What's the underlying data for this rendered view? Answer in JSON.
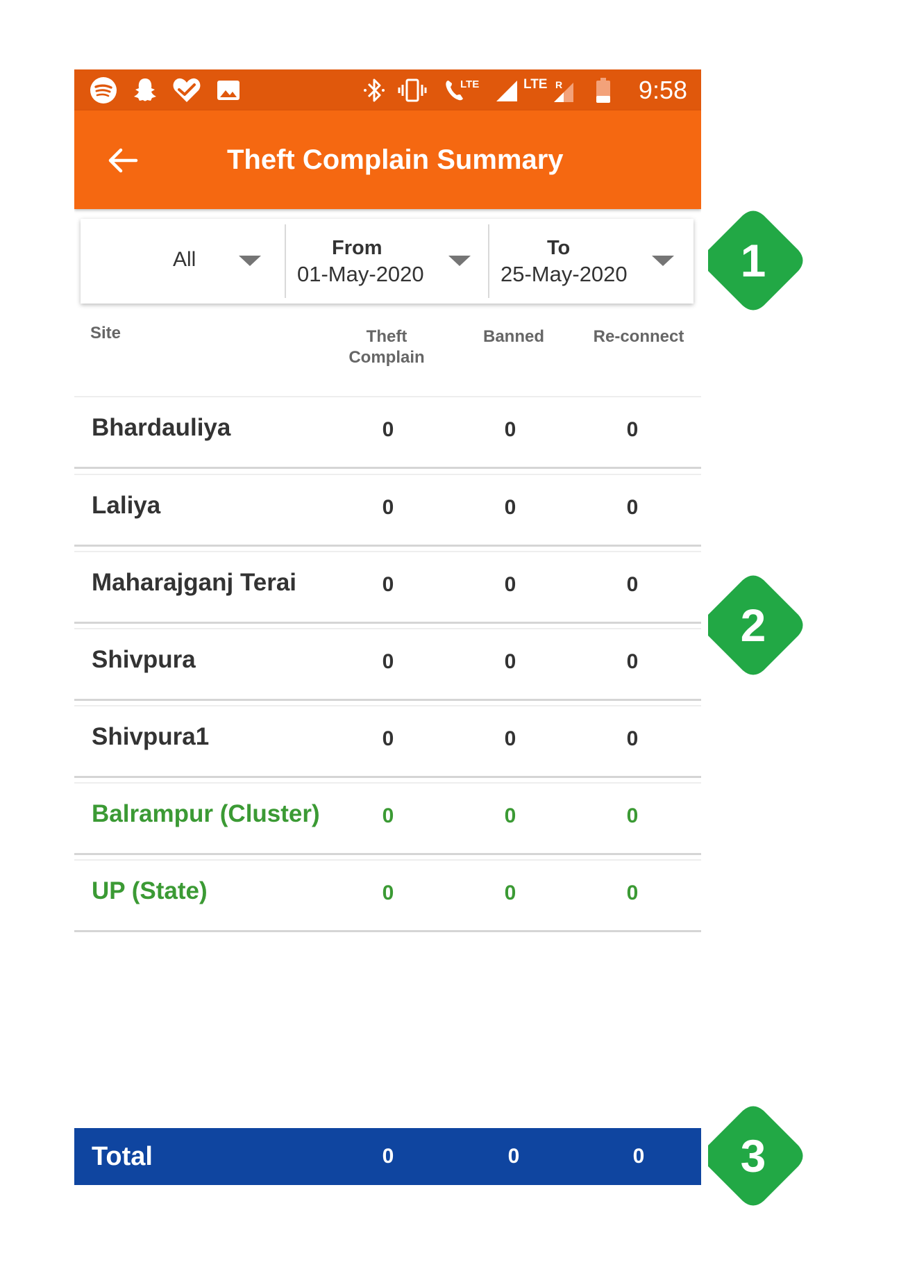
{
  "status_bar": {
    "time": "9:58",
    "left_icons": [
      "spotify-icon",
      "snapchat-icon",
      "health-heart-icon",
      "gallery-image-icon"
    ],
    "right_icons": [
      "bluetooth-icon",
      "vibrate-icon",
      "volte-call-icon",
      "signal-icon",
      "lte-roaming-signal-icon",
      "battery-icon"
    ],
    "lte_label": "LTE",
    "lte2_label": "LTE",
    "roaming_label": "R"
  },
  "app_bar": {
    "title": "Theft Complain Summary",
    "back_icon": "arrow-left-icon"
  },
  "filters": {
    "site_filter": "All",
    "from_label": "From",
    "from_value": "01-May-2020",
    "to_label": "To",
    "to_value": "25-May-2020"
  },
  "table": {
    "headers": {
      "site": "Site",
      "theft_line1": "Theft",
      "theft_line2": "Complain",
      "banned": "Banned",
      "reconnect": "Re-connect"
    },
    "rows": [
      {
        "site": "Bhardauliya",
        "theft": "0",
        "banned": "0",
        "reconnect": "0",
        "highlight": false
      },
      {
        "site": "Laliya",
        "theft": "0",
        "banned": "0",
        "reconnect": "0",
        "highlight": false
      },
      {
        "site": "Maharajganj Terai",
        "theft": "0",
        "banned": "0",
        "reconnect": "0",
        "highlight": false
      },
      {
        "site": "Shivpura",
        "theft": "0",
        "banned": "0",
        "reconnect": "0",
        "highlight": false
      },
      {
        "site": "Shivpura1",
        "theft": "0",
        "banned": "0",
        "reconnect": "0",
        "highlight": false
      },
      {
        "site": "Balrampur (Cluster)",
        "theft": "0",
        "banned": "0",
        "reconnect": "0",
        "highlight": true
      },
      {
        "site": "UP (State)",
        "theft": "0",
        "banned": "0",
        "reconnect": "0",
        "highlight": true
      }
    ]
  },
  "total": {
    "label": "Total",
    "theft": "0",
    "banned": "0",
    "reconnect": "0"
  },
  "callouts": [
    "1",
    "2",
    "3"
  ],
  "colors": {
    "status_bar": "#e0580c",
    "app_bar": "#f56811",
    "total_bar": "#0f45a0",
    "highlight_text": "#3b9a34",
    "callout": "#22a845"
  }
}
